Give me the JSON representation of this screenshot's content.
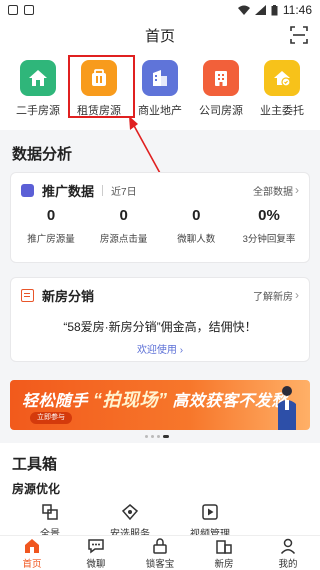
{
  "status_bar": {
    "time": "11:46"
  },
  "header": {
    "title": "首页"
  },
  "entries": [
    {
      "label": "二手房源",
      "color": "#2fb67a",
      "icon": "house-icon"
    },
    {
      "label": "租赁房源",
      "color": "#f89b1c",
      "icon": "rental-icon"
    },
    {
      "label": "商业地产",
      "color": "#5f74d9",
      "icon": "building-icon"
    },
    {
      "label": "公司房源",
      "color": "#f2603a",
      "icon": "company-icon"
    },
    {
      "label": "业主委托",
      "color": "#f7c21a",
      "icon": "owner-icon"
    }
  ],
  "data_section": {
    "title": "数据分析"
  },
  "promo": {
    "title": "推广数据",
    "range": "近7日",
    "more": "全部数据",
    "stats": [
      {
        "value": "0",
        "caption": "推广房源量"
      },
      {
        "value": "0",
        "caption": "房源点击量"
      },
      {
        "value": "0",
        "caption": "微聊人数"
      },
      {
        "value": "0%",
        "caption": "3分钟回复率"
      }
    ]
  },
  "new_house": {
    "title": "新房分销",
    "more": "了解新房",
    "slogan": "“58爱房·新房分销”佣金高，结佣快！",
    "welcome": "欢迎使用"
  },
  "banner": {
    "text_a": "轻松随手",
    "text_b": "“拍现场”",
    "text_c": "高效获客不发愁",
    "button": "立即参与"
  },
  "toolbox": {
    "title": "工具箱",
    "subtitle": "房源优化",
    "tools": [
      {
        "label": "全景"
      },
      {
        "label": "安选服务"
      },
      {
        "label": "视频管理"
      }
    ]
  },
  "tabs": [
    {
      "label": "首页",
      "active": true
    },
    {
      "label": "微聊"
    },
    {
      "label": "锁客宝"
    },
    {
      "label": "新房"
    },
    {
      "label": "我的"
    }
  ],
  "colors": {
    "accent": "#f0561f",
    "highlight": "#e02020",
    "link": "#5b6fd6"
  }
}
